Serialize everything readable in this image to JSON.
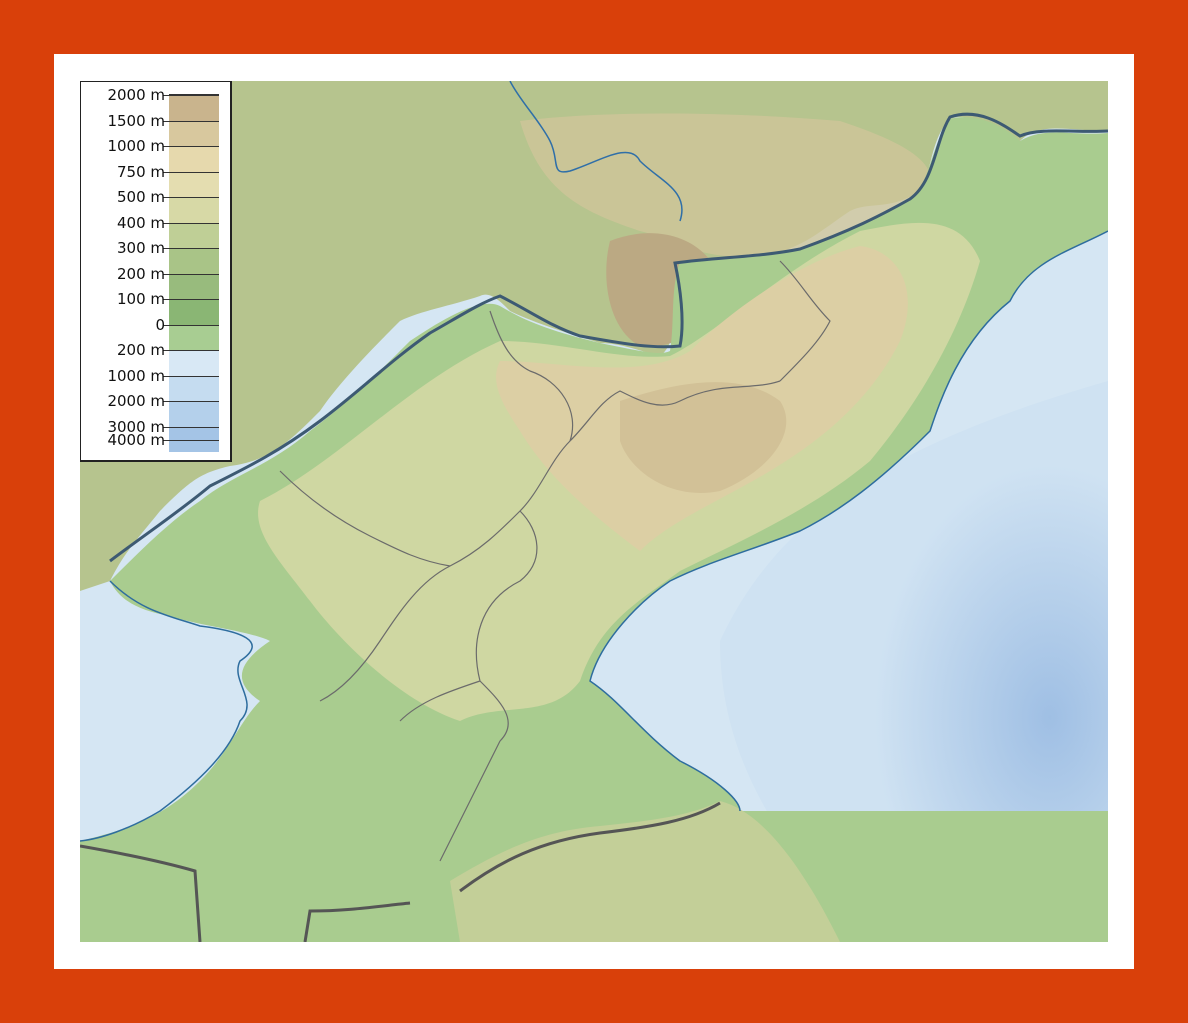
{
  "legend": {
    "entries": [
      {
        "label": "2000 m",
        "color": "#c9b48d"
      },
      {
        "label": "1500 m",
        "color": "#d8c89e"
      },
      {
        "label": "1000 m",
        "color": "#e6d9ad"
      },
      {
        "label": "750 m",
        "color": "#e4ddb0"
      },
      {
        "label": "500 m",
        "color": "#d7d9a6"
      },
      {
        "label": "400 m",
        "color": "#bfcf96"
      },
      {
        "label": "300 m",
        "color": "#a9c487"
      },
      {
        "label": "200 m",
        "color": "#98bb7d"
      },
      {
        "label": "100 m",
        "color": "#8ab674"
      },
      {
        "label": "0",
        "color": "#a8cd92"
      },
      {
        "label": "200 m",
        "color": "#d8e8f5"
      },
      {
        "label": "1000 m",
        "color": "#c5dcf0"
      },
      {
        "label": "2000 m",
        "color": "#b4d0eb"
      },
      {
        "label": "3000 m",
        "color": "#a4c4e6"
      },
      {
        "label": "4000 m",
        "color": "#94b7e1"
      }
    ]
  },
  "colors": {
    "frame": "#d9400a",
    "sea_shallow": "#d5e6f3",
    "sea_deep": "#a9c8e8",
    "lowland": "#a8cd92",
    "hill": "#c5d39c",
    "highland": "#d7c99c",
    "mountain": "#c4ae84",
    "international_border": "#555555",
    "province_border": "#6b6b6b",
    "river": "#2f6fa8",
    "coast": "#2e6d9e"
  }
}
